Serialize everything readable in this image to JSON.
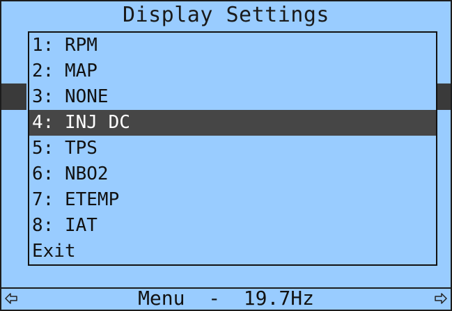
{
  "screen": {
    "title": "Display Settings",
    "menu": {
      "items": [
        {
          "label": "1: RPM"
        },
        {
          "label": "2: MAP"
        },
        {
          "label": "3: NONE"
        },
        {
          "label": "4: INJ DC",
          "selected": true
        },
        {
          "label": "5: TPS"
        },
        {
          "label": "6: NBO2"
        },
        {
          "label": "7: ETEMP"
        },
        {
          "label": "8: IAT"
        },
        {
          "label": "Exit"
        }
      ]
    },
    "footer": {
      "text": "Menu  -  19.7Hz",
      "left_icon": "left-arrow-icon",
      "right_icon": "right-arrow-icon"
    },
    "colors": {
      "background": "#99ccff",
      "selection": "#464646",
      "text": "#111111"
    }
  }
}
